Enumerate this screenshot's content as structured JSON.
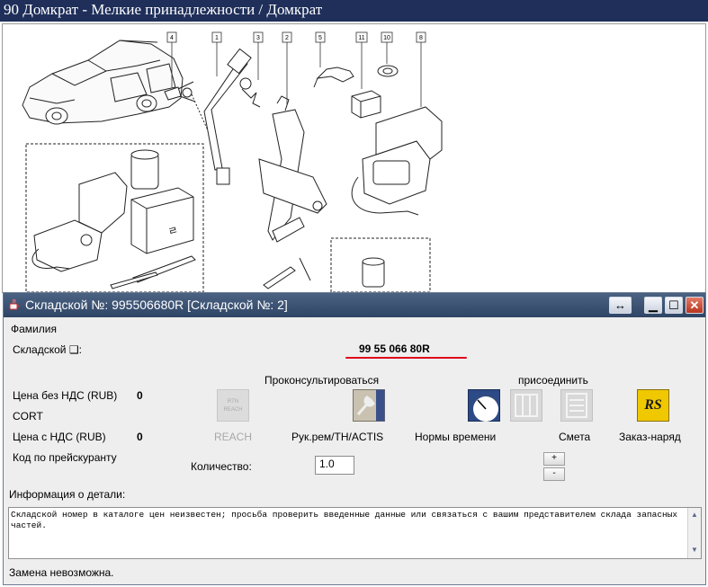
{
  "page_title": "90 Домкрат - Мелкие принадлежности / Домкрат",
  "diagram": {
    "callouts": [
      "4",
      "1",
      "3",
      "2",
      "5",
      "11",
      "10",
      "8"
    ]
  },
  "dialog": {
    "title": "Складской №: 995506680R [Складской №: 2]",
    "swap_icon_glyph": "↔",
    "minimize_glyph": "▁",
    "maximize_glyph": "☐",
    "close_glyph": "✕",
    "surname_label": "Фамилия",
    "stock_label": "Складской ❑:",
    "part_number": "99 55 066 80R",
    "consult_label": "Проконсультироваться",
    "attach_label": "присоединить",
    "price_no_vat_label": "Цена без НДС (RUB)",
    "price_no_vat_value": "0",
    "cort_label": "CORT",
    "price_vat_label": "Цена с НДС (RUB)",
    "price_vat_value": "0",
    "price_code_label": "Код по прейскуранту",
    "reach_icon_text": "RTN REACH",
    "reach_label": "REACH",
    "repair_manual_label": "Рук.рем/TH/ACTIS",
    "time_norms_label": "Нормы времени",
    "estimate_label": "Смета",
    "work_order_label": "Заказ-наряд",
    "work_order_icon_text": "RS",
    "quantity_label": "Количество:",
    "quantity_value": "1.0",
    "plus_label": "+",
    "minus_label": "-",
    "part_info_label": "Информация о детали:",
    "part_info_text": "Складской номер в каталоге цен неизвестен; просьба проверить введенные данные или связаться с вашим представителем склада запасных частей.",
    "status_text": "Замена невозможна.",
    "accent_color": "#e0001a"
  }
}
